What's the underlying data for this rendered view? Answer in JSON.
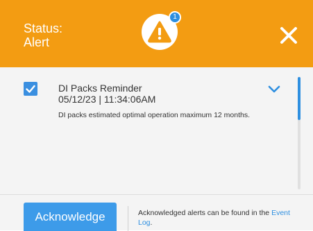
{
  "header": {
    "status_label": "Status:",
    "status_value": "Alert",
    "alert_count": "1",
    "background_color": "#f39c12",
    "icon_warning": "warning-triangle-icon",
    "icon_close": "close-icon"
  },
  "alert": {
    "checked": true,
    "name": "DI Packs Reminder",
    "timestamp": "05/12/23 | 11:34:06AM",
    "description": "DI packs estimated optimal operation maximum 12 months.",
    "icon_expand": "chevron-down-icon"
  },
  "footer": {
    "acknowledge_label": "Acknowledge",
    "note_text": "Acknowledged alerts can be found in the",
    "event_log_link": "Event Log",
    "note_suffix": "."
  },
  "colors": {
    "accent": "#3d9be9",
    "link": "#2e8fe0"
  }
}
